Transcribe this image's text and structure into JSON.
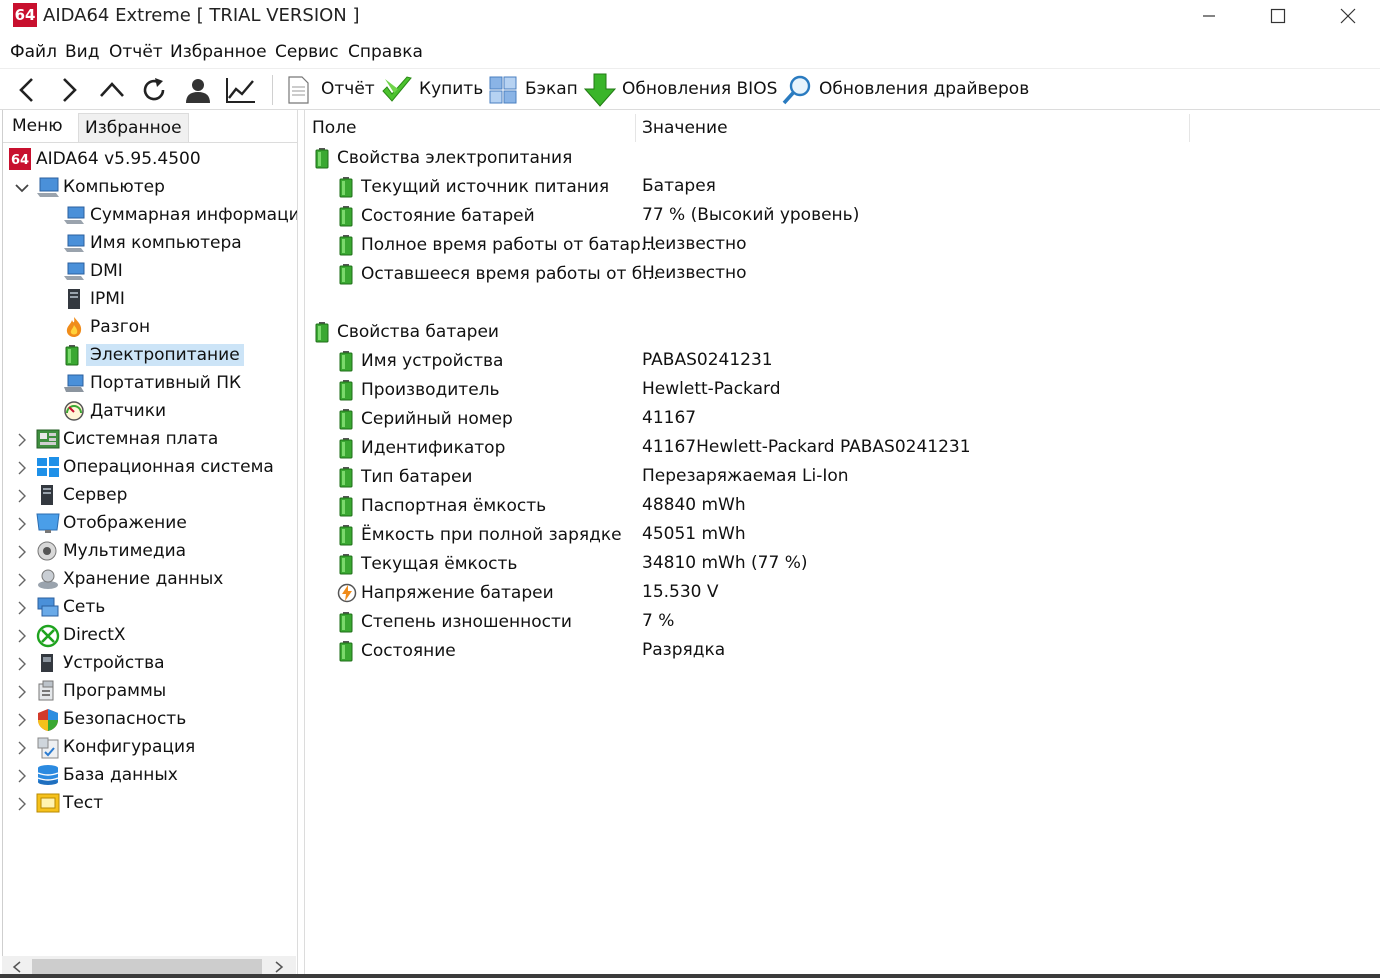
{
  "window": {
    "logo": "64",
    "title": "AIDA64 Extreme  [ TRIAL VERSION ]"
  },
  "menu": [
    "Файл",
    "Вид",
    "Отчёт",
    "Избранное",
    "Сервис",
    "Справка"
  ],
  "toolbar": {
    "report": "Отчёт",
    "buy": "Купить",
    "backup": "Бэкап",
    "bios": "Обновления BIOS",
    "drivers": "Обновления драйверов"
  },
  "left_tabs": {
    "menu": "Меню",
    "favorites": "Избранное"
  },
  "tree": {
    "root": "AIDA64 v5.95.4500",
    "computer": "Компьютер",
    "computer_children": [
      {
        "label": "Суммарная информация",
        "icon": "monitor-icon"
      },
      {
        "label": "Имя компьютера",
        "icon": "monitor-icon"
      },
      {
        "label": "DMI",
        "icon": "monitor-icon"
      },
      {
        "label": "IPMI",
        "icon": "server-icon"
      },
      {
        "label": "Разгон",
        "icon": "flame-icon"
      },
      {
        "label": "Электропитание",
        "icon": "battery-icon"
      },
      {
        "label": "Портативный ПК",
        "icon": "laptop-icon"
      },
      {
        "label": "Датчики",
        "icon": "gauge-icon"
      }
    ],
    "top_items": [
      {
        "label": "Системная плата",
        "icon": "motherboard-icon"
      },
      {
        "label": "Операционная система",
        "icon": "windows-icon"
      },
      {
        "label": "Сервер",
        "icon": "server-icon"
      },
      {
        "label": "Отображение",
        "icon": "display-icon"
      },
      {
        "label": "Мультимедиа",
        "icon": "speaker-icon"
      },
      {
        "label": "Хранение данных",
        "icon": "disk-icon"
      },
      {
        "label": "Сеть",
        "icon": "network-icon"
      },
      {
        "label": "DirectX",
        "icon": "xbox-icon"
      },
      {
        "label": "Устройства",
        "icon": "device-icon"
      },
      {
        "label": "Программы",
        "icon": "programs-icon"
      },
      {
        "label": "Безопасность",
        "icon": "shield-icon"
      },
      {
        "label": "Конфигурация",
        "icon": "config-icon"
      },
      {
        "label": "База данных",
        "icon": "database-icon"
      },
      {
        "label": "Тест",
        "icon": "test-icon"
      }
    ]
  },
  "columns": {
    "field": "Поле",
    "value": "Значение"
  },
  "groups": [
    {
      "title": "Свойства электропитания",
      "rows": [
        {
          "field": "Текущий источник питания",
          "value": "Батарея",
          "icon": "battery-icon"
        },
        {
          "field": "Состояние батарей",
          "value": "77 % (Высокий уровень)",
          "icon": "battery-icon"
        },
        {
          "field": "Полное время работы от батар...",
          "value": "Неизвестно",
          "icon": "battery-icon"
        },
        {
          "field": "Оставшееся время работы от б...",
          "value": "Неизвестно",
          "icon": "battery-icon"
        }
      ]
    },
    {
      "title": "Свойства батареи",
      "rows": [
        {
          "field": "Имя устройства",
          "value": "PABAS0241231",
          "icon": "battery-icon"
        },
        {
          "field": "Производитель",
          "value": "Hewlett-Packard",
          "icon": "battery-icon"
        },
        {
          "field": "Серийный номер",
          "value": "41167",
          "icon": "battery-icon"
        },
        {
          "field": "Идентификатор",
          "value": "41167Hewlett-Packard PABAS0241231",
          "icon": "battery-icon"
        },
        {
          "field": "Тип батареи",
          "value": "Перезаряжаемая Li-Ion",
          "icon": "battery-icon"
        },
        {
          "field": "Паспортная ёмкость",
          "value": "48840 mWh",
          "icon": "battery-icon"
        },
        {
          "field": "Ёмкость при полной зарядке",
          "value": "45051 mWh",
          "icon": "battery-icon"
        },
        {
          "field": "Текущая ёмкость",
          "value": "34810 mWh  (77 %)",
          "icon": "battery-icon"
        },
        {
          "field": "Напряжение батареи",
          "value": "15.530 V",
          "icon": "voltage-icon"
        },
        {
          "field": "Степень изношенности",
          "value": "7 %",
          "icon": "battery-icon"
        },
        {
          "field": "Состояние",
          "value": "Разрядка",
          "icon": "battery-icon"
        }
      ]
    }
  ],
  "colors": {
    "selection": "#cce4f7",
    "battery": "#3aa832",
    "logo": "#c8102e"
  }
}
